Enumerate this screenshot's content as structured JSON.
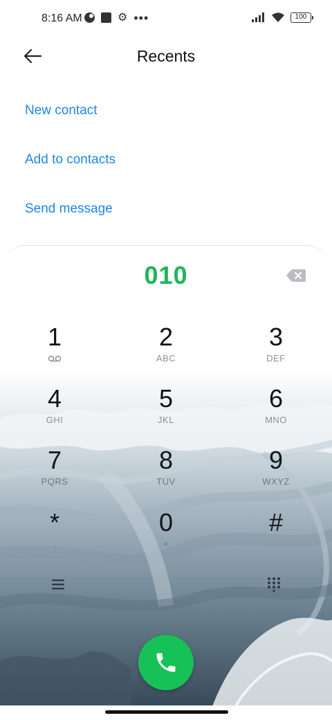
{
  "status_bar": {
    "time": "8:16 AM",
    "battery": "100",
    "icons": [
      "data-saver-icon",
      "square-notification-icon",
      "gear-icon",
      "more-dots-icon",
      "signal-icon",
      "wifi-icon",
      "battery-icon"
    ]
  },
  "header": {
    "title": "Recents",
    "back_icon": "arrow-left-icon"
  },
  "options": [
    {
      "label": "New contact"
    },
    {
      "label": "Add to contacts"
    },
    {
      "label": "Send message"
    }
  ],
  "dialer": {
    "number": "010",
    "number_color": "#1fb55a",
    "keys": [
      {
        "digit": "1",
        "sub": ""
      },
      {
        "digit": "2",
        "sub": "ABC"
      },
      {
        "digit": "3",
        "sub": "DEF"
      },
      {
        "digit": "4",
        "sub": "GHI"
      },
      {
        "digit": "5",
        "sub": "JKL"
      },
      {
        "digit": "6",
        "sub": "MNO"
      },
      {
        "digit": "7",
        "sub": "PQRS"
      },
      {
        "digit": "8",
        "sub": "TUV"
      },
      {
        "digit": "9",
        "sub": "WXYZ"
      },
      {
        "digit": "*",
        "sub": ","
      },
      {
        "digit": "0",
        "sub": "+"
      },
      {
        "digit": "#",
        "sub": ""
      }
    ],
    "call_color": "#16c157",
    "accent_link_color": "#1d86e8"
  }
}
